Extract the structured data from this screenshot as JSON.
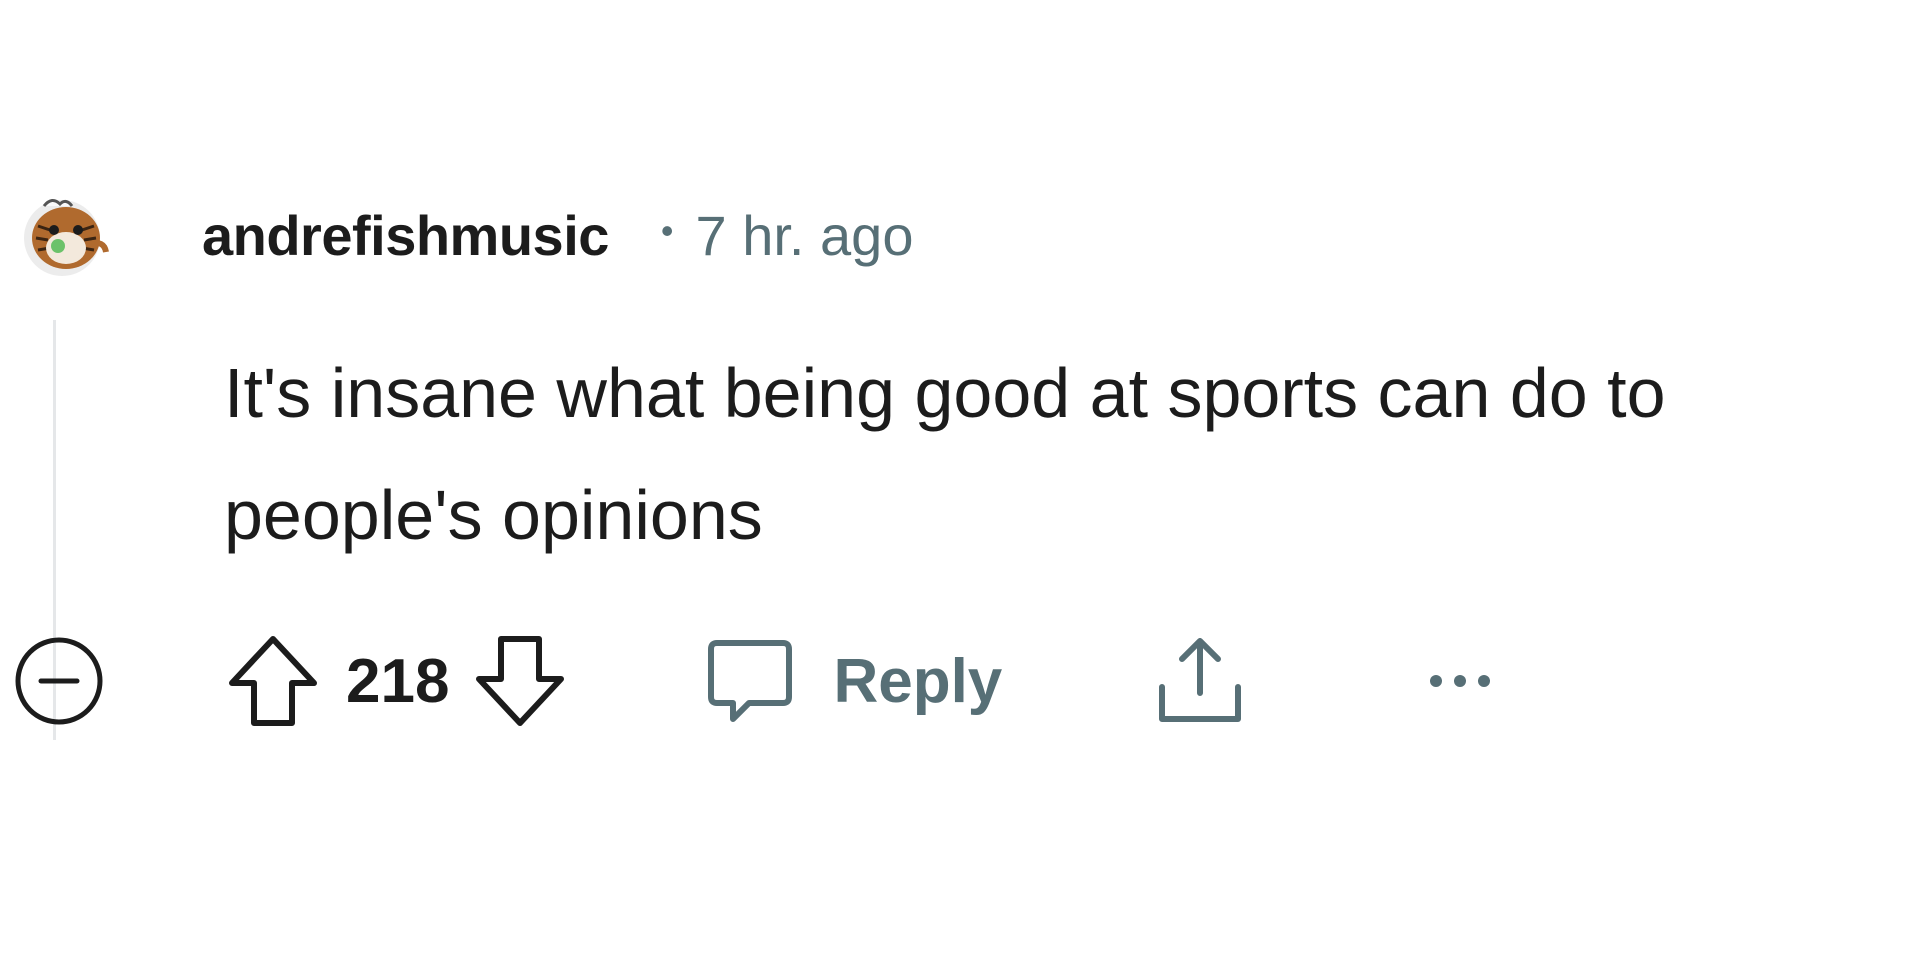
{
  "comment": {
    "username": "andrefishmusic",
    "separator": "•",
    "timestamp": "7 hr. ago",
    "body": "It's insane what being good at sports can do to people's opinions",
    "score": "218",
    "reply_label": "Reply"
  },
  "icons": {
    "avatar": "tiger-snoo-avatar",
    "collapse": "collapse-minus-circle-icon",
    "upvote": "upvote-arrow-icon",
    "downvote": "downvote-arrow-icon",
    "reply": "speech-bubble-icon",
    "share": "share-upload-icon",
    "more": "ellipsis-icon"
  },
  "colors": {
    "text": "#1c1c1c",
    "meta": "#576f76",
    "thread_line": "#e5e7e9"
  }
}
